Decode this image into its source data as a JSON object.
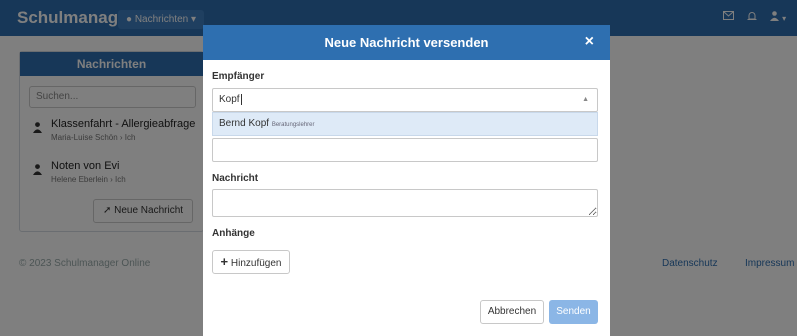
{
  "navbar": {
    "brand": "Schulmanager",
    "menu_label": "Nachrichten",
    "menu_caret": "▾",
    "right_icons": [
      "envelope-icon",
      "bell-icon",
      "user-icon"
    ]
  },
  "panel": {
    "title": "Nachrichten",
    "search_placeholder": "Suchen...",
    "messages": [
      {
        "title": "Klassenfahrt - Allergieabfrage",
        "subtitle": "Maria-Luise Schön › Ich"
      },
      {
        "title": "Noten von Evi",
        "subtitle": "Helene Eberlein › Ich"
      }
    ],
    "new_button": "Neue Nachricht"
  },
  "footer": {
    "copyright": "© 2023 Schulmanager Online",
    "links": [
      "Datenschutz",
      "Impressum"
    ]
  },
  "modal": {
    "title": "Neue Nachricht versenden",
    "close": "×",
    "recipients_label": "Empfänger",
    "recipients_value": "Kopf",
    "suggestion_name": "Bernd Kopf",
    "suggestion_role": "Beratungslehrer",
    "message_label": "Nachricht",
    "message_value": "",
    "attachments_label": "Anhänge",
    "add_button": "Hinzufügen",
    "cancel_button": "Abbrechen",
    "send_button": "Senden"
  },
  "colors": {
    "primary": "#2e6fb0",
    "send_disabled": "#8bb6e6",
    "dropdown_highlight": "#deeaf7"
  }
}
